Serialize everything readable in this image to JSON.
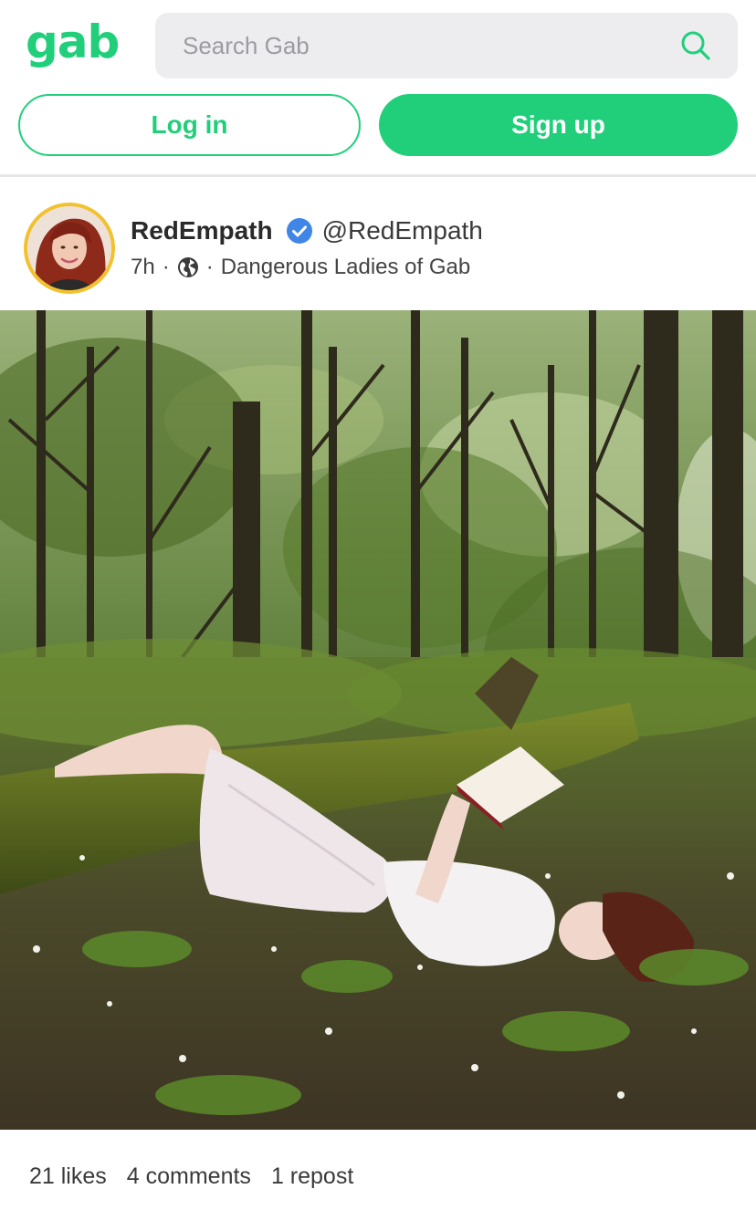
{
  "header": {
    "logo": "gab",
    "search": {
      "placeholder": "Search Gab",
      "icon": "search-icon"
    },
    "login_label": "Log in",
    "signup_label": "Sign up",
    "accent_color": "#21cf7a"
  },
  "post": {
    "author": {
      "display_name": "RedEmpath",
      "handle": "@RedEmpath",
      "verified": true,
      "avatar": "avatar-photo"
    },
    "time": "7h",
    "visibility_icon": "globe-icon",
    "group": "Dangerous Ladies of Gab",
    "image": "forest-reading-photo",
    "stats": {
      "likes": "21 likes",
      "comments": "4 comments",
      "reposts": "1 repost"
    }
  }
}
